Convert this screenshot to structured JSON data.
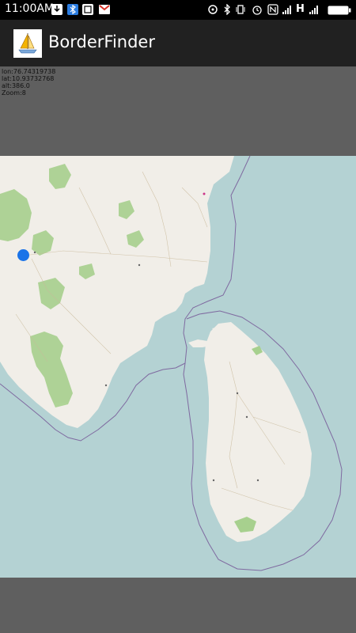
{
  "status_bar": {
    "time": "11:00AM",
    "network": "H"
  },
  "app_bar": {
    "title": "BorderFinder"
  },
  "info": {
    "lon": "lon:76.74319738",
    "lat": "lat:10.93732768",
    "alt": "alt:386.0",
    "zoom": "Zoom:8"
  },
  "map": {
    "colors": {
      "sea": "#b4d2d3",
      "land": "#f1eee8",
      "forest": "#a7d08e",
      "border": "#7f6aa0",
      "location": "#1a73e8"
    }
  }
}
